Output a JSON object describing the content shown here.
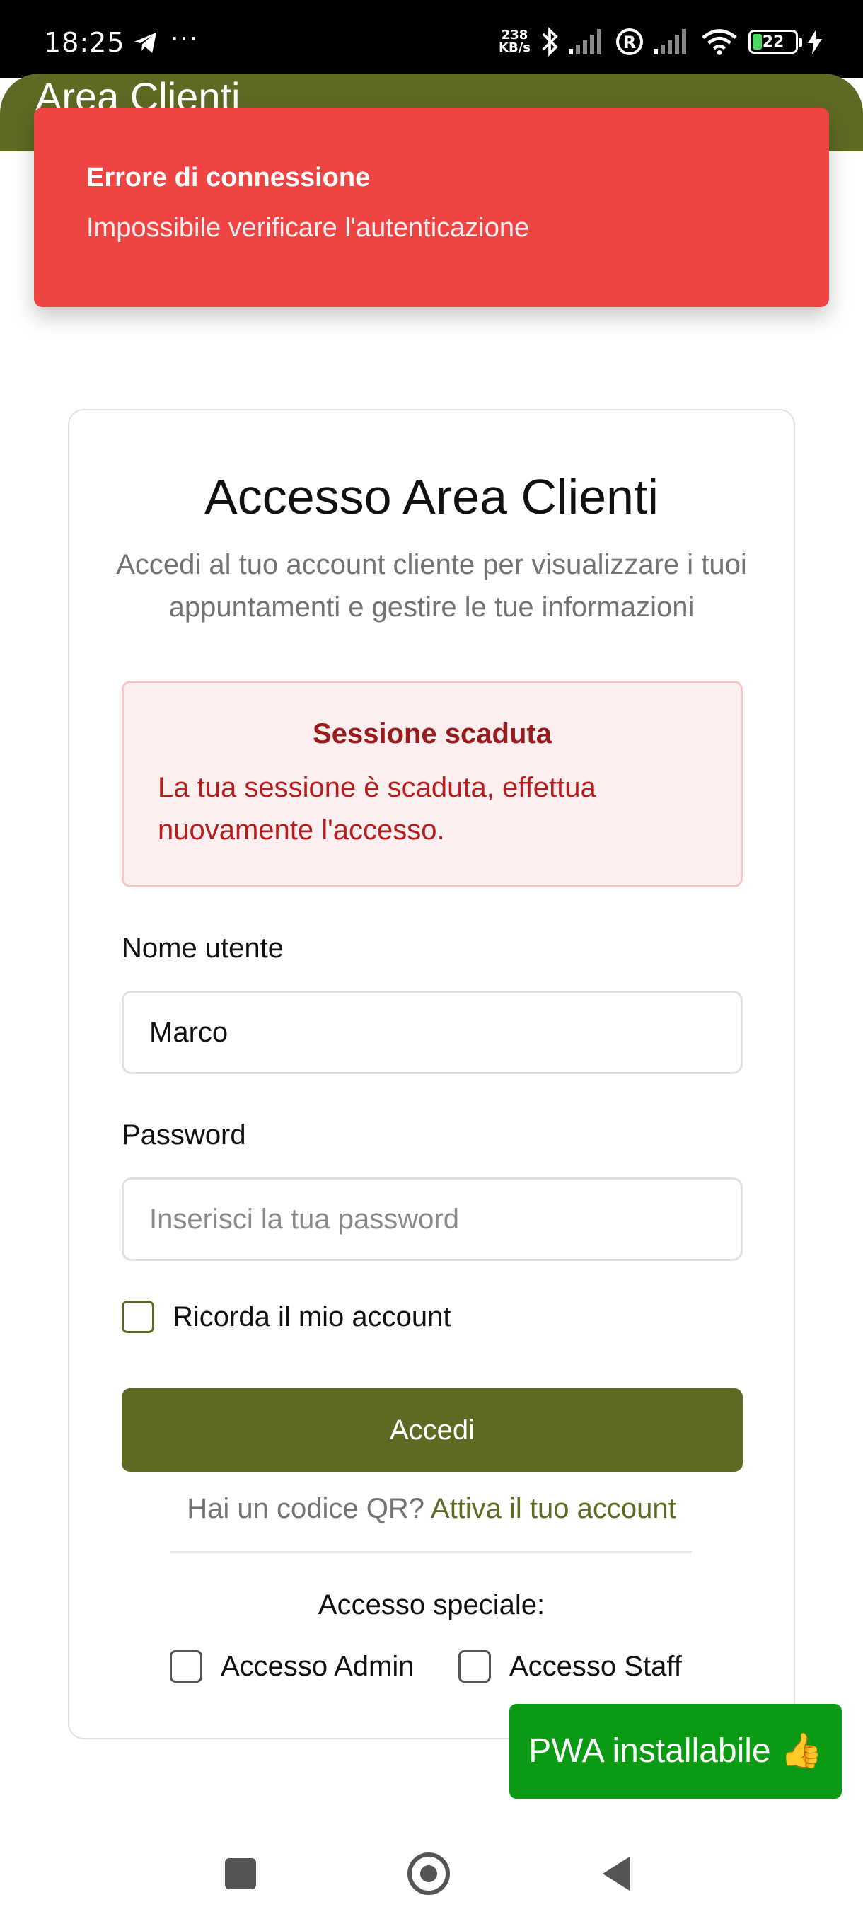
{
  "status_bar": {
    "time": "18:25",
    "dots": "···",
    "speed_value": "238",
    "speed_unit": "KB/s",
    "battery": "22",
    "battery_level": 0.22
  },
  "header": {
    "title": "Area Clienti",
    "color": "#5e6a23"
  },
  "toast": {
    "title": "Errore di connessione",
    "message": "Impossibile verificare l'autenticazione",
    "color": "#ef4444"
  },
  "card": {
    "title": "Accesso Area Clienti",
    "subtitle": "Accedi al tuo account cliente per visualizzare i tuoi appuntamenti e gestire le tue informazioni"
  },
  "alert": {
    "title": "Sessione scaduta",
    "message": "La tua sessione è scaduta, effettua nuovamente l'accesso."
  },
  "form": {
    "username_label": "Nome utente",
    "username_value": "Marco",
    "password_label": "Password",
    "password_placeholder": "Inserisci la tua password",
    "remember_label": "Ricorda il mio account",
    "submit_label": "Accedi",
    "qr_prompt": "Hai un codice QR?",
    "qr_link": "Attiva il tuo account"
  },
  "special_access": {
    "label": "Accesso speciale:",
    "admin_label": "Accesso Admin",
    "staff_label": "Accesso Staff"
  },
  "pwa_badge": {
    "text": "PWA installabile 👍",
    "color": "#0a9a14"
  },
  "icons": {
    "telegram": "telegram-icon",
    "bluetooth": "bluetooth-icon",
    "signal": "signal-icon",
    "roaming": "roaming-icon",
    "wifi": "wifi-icon",
    "charging": "charging-icon"
  }
}
